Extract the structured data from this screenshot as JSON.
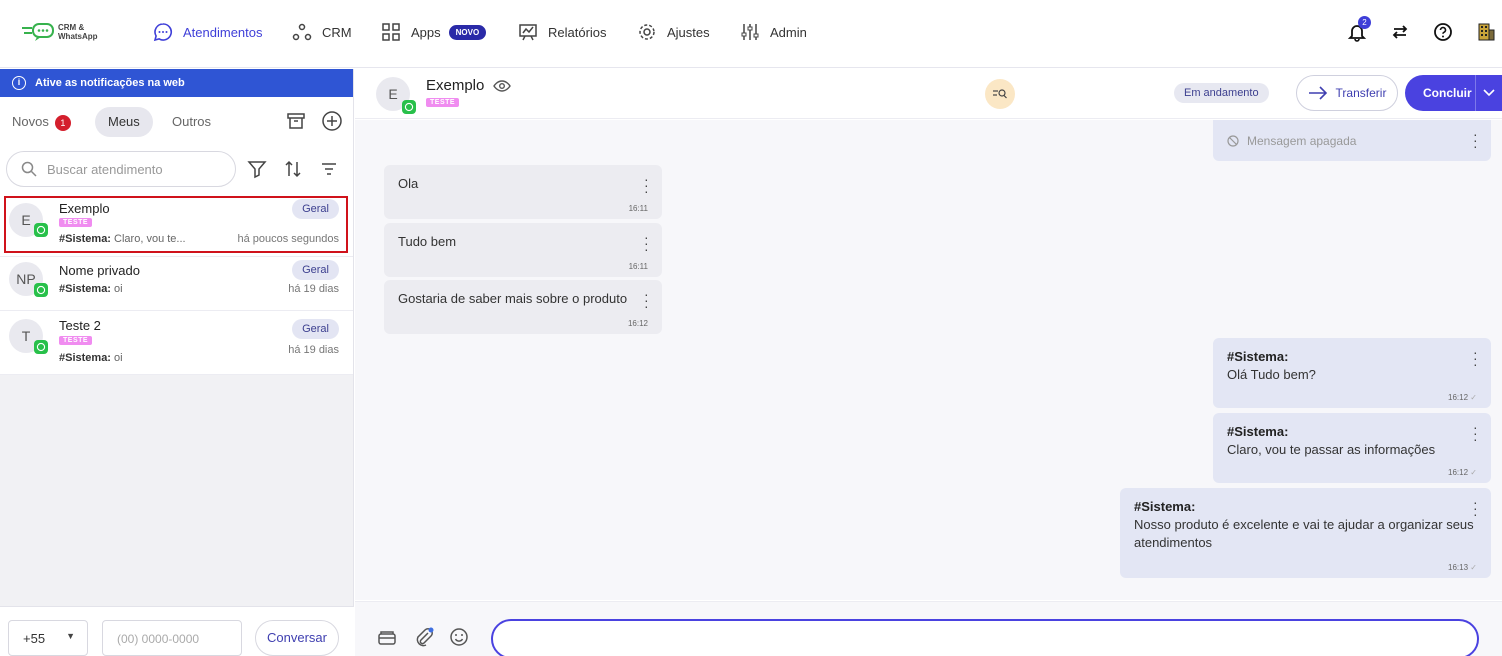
{
  "brand": {
    "line1": "CRM &",
    "line2": "WhatsApp"
  },
  "nav": {
    "atendimentos": "Atendimentos",
    "crm": "CRM",
    "apps": "Apps",
    "apps_badge": "NOVO",
    "relatorios": "Relatórios",
    "ajustes": "Ajustes",
    "admin": "Admin",
    "notifications_count": "2",
    "accent": "#3f3fd8"
  },
  "left": {
    "notice": "Ative as notificações na web",
    "tabs": {
      "novos": "Novos",
      "novos_count": "1",
      "meus": "Meus",
      "outros": "Outros"
    },
    "search_placeholder": "Buscar atendimento",
    "items": [
      {
        "initials": "E",
        "name": "Exemplo",
        "tag": "TESTE",
        "preview_sender": "#Sistema:",
        "preview_text": "Claro, vou te...",
        "queue": "Geral",
        "time": "há poucos segundos"
      },
      {
        "initials": "NP",
        "name": "Nome privado",
        "preview_sender": "#Sistema:",
        "preview_text": "oi",
        "queue": "Geral",
        "time": "há 19 dias"
      },
      {
        "initials": "T",
        "name": "Teste 2",
        "tag": "TESTE",
        "preview_sender": "#Sistema:",
        "preview_text": "oi",
        "queue": "Geral",
        "time": "há 19 dias"
      }
    ],
    "ddi": "+55",
    "phone_placeholder": "(00) 0000-0000",
    "conversar": "Conversar"
  },
  "chat": {
    "initials": "E",
    "name": "Exemplo",
    "tag": "TESTE",
    "status": "Em andamento",
    "transferir": "Transferir",
    "concluir": "Concluir",
    "deleted": "Mensagem apagada",
    "messages": [
      {
        "text": "Ola",
        "time": "16:11"
      },
      {
        "text": "Tudo bem",
        "time": "16:11"
      },
      {
        "text": "Gostaria de saber mais sobre o produto",
        "time": "16:12"
      },
      {
        "sender": "#Sistema:",
        "text": "Olá Tudo bem?",
        "time": "16:12"
      },
      {
        "sender": "#Sistema:",
        "text": "Claro, vou te passar as informações",
        "time": "16:12"
      },
      {
        "sender": "#Sistema:",
        "text": "Nosso produto é excelente e vai te ajudar a organizar seus atendimentos",
        "time": "16:13"
      }
    ]
  }
}
